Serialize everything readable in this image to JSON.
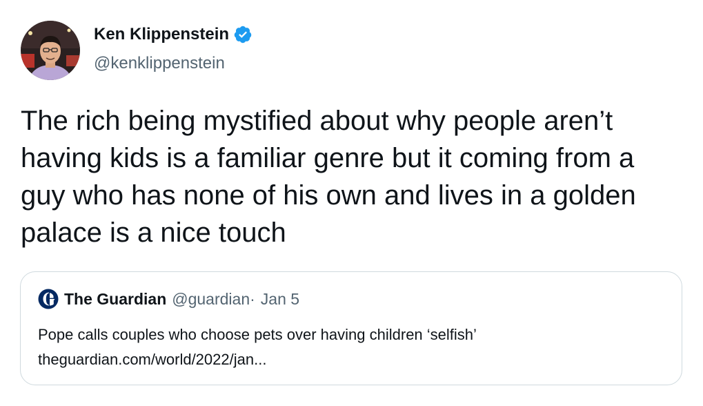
{
  "author": {
    "name": "Ken Klippenstein",
    "handle": "@kenklippenstein",
    "verified": true,
    "verified_color": "#1d9bf0"
  },
  "tweet": {
    "text": "The rich being mystified about why people aren’t\nhaving kids is a familiar genre but it coming from a\nguy who has none of his own and lives in a golden\npalace is a nice touch"
  },
  "quote": {
    "name": "The Guardian",
    "handle": "@guardian",
    "dot": "·",
    "date": "Jan 5",
    "text": "Pope calls couples who choose pets over having children ‘selfish’",
    "link": "theguardian.com/world/2022/jan..."
  },
  "icons": {
    "verified": "verified-badge-icon",
    "quote_logo": "guardian-logo-icon"
  },
  "colors": {
    "text": "#0f1419",
    "secondary": "#536471",
    "border": "#cfd9de",
    "guardian_blue": "#052962"
  }
}
